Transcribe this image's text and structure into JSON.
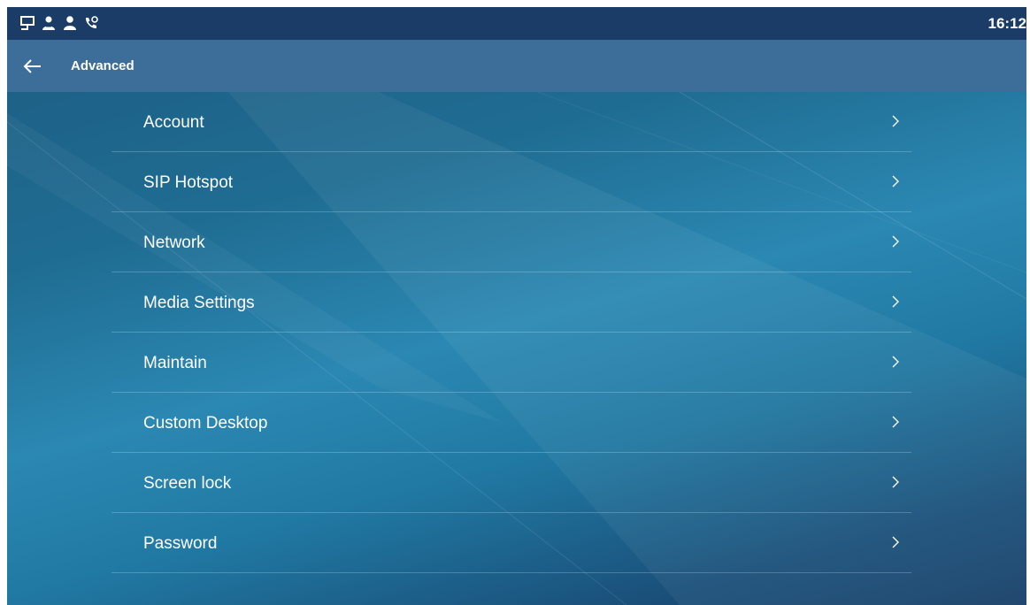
{
  "status_bar": {
    "icons": [
      "network-icon",
      "contacts-icon",
      "user-icon",
      "call-forward-icon"
    ],
    "time": "16:12"
  },
  "header": {
    "back_icon": "arrow-left-icon",
    "title": "Advanced"
  },
  "menu": {
    "chevron_icon": "chevron-right-icon",
    "items": [
      {
        "label": "Account"
      },
      {
        "label": "SIP Hotspot"
      },
      {
        "label": "Network"
      },
      {
        "label": "Media Settings"
      },
      {
        "label": "Maintain"
      },
      {
        "label": "Custom Desktop"
      },
      {
        "label": "Screen lock"
      },
      {
        "label": "Password"
      }
    ]
  },
  "colors": {
    "status_bar_bg": "#1b3c66",
    "title_bar_bg": "#3d6e99",
    "background_mid": "#2b88b2",
    "text": "#ffffff"
  }
}
